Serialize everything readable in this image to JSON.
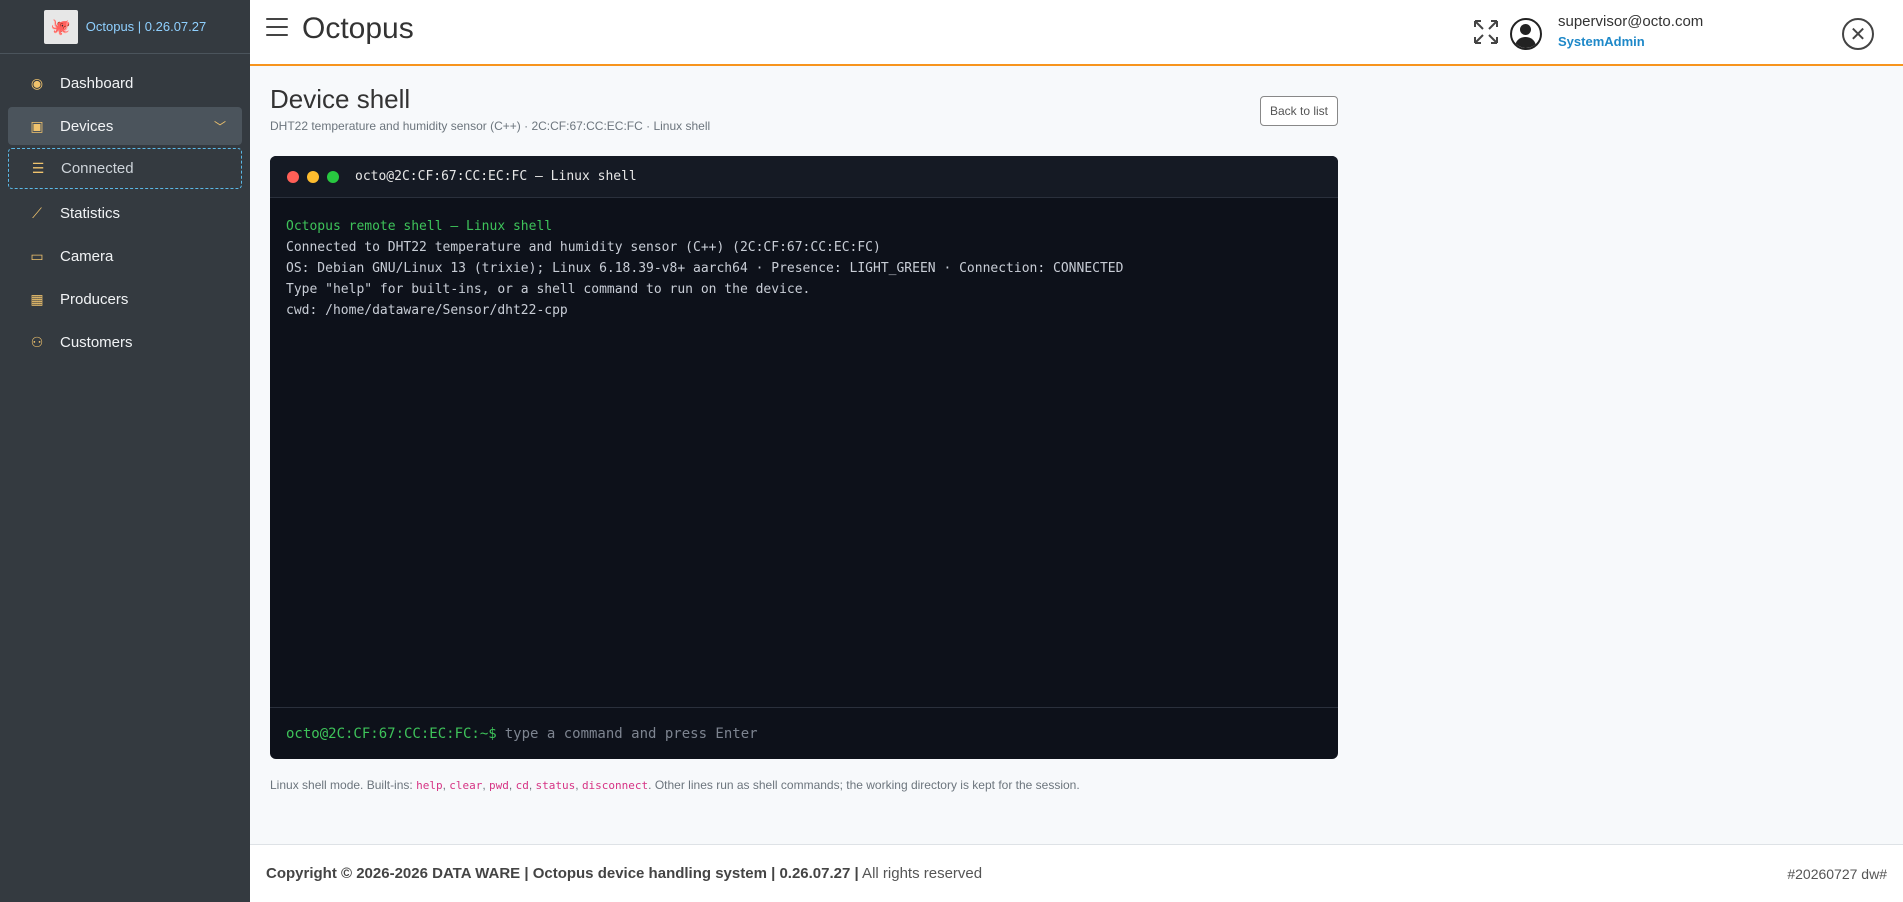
{
  "brand": {
    "name": "Octopus | 0.26.07.27"
  },
  "sidebar": {
    "items": [
      {
        "label": "Dashboard",
        "icon": "palette-icon"
      },
      {
        "label": "Devices",
        "icon": "chip-icon"
      },
      {
        "label": "Connected",
        "icon": "sliders-icon"
      },
      {
        "label": "Statistics",
        "icon": "chart-line-icon"
      },
      {
        "label": "Camera",
        "icon": "video-icon"
      },
      {
        "label": "Producers",
        "icon": "building-icon"
      },
      {
        "label": "Customers",
        "icon": "users-icon"
      }
    ]
  },
  "header": {
    "title": "Octopus",
    "user_email": "supervisor@octo.com",
    "user_role": "SystemAdmin"
  },
  "page": {
    "title": "Device shell",
    "subtitle": "DHT22 temperature and humidity sensor (C++) · 2C:CF:67:CC:EC:FC · Linux shell",
    "back_label": "Back to list"
  },
  "terminal": {
    "title": "octo@2C:CF:67:CC:EC:FC — Linux shell",
    "lines": [
      "Octopus remote shell — Linux shell",
      "Connected to DHT22 temperature and humidity sensor (C++) (2C:CF:67:CC:EC:FC)",
      "OS: Debian GNU/Linux 13 (trixie); Linux 6.18.39-v8+ aarch64 · Presence: LIGHT_GREEN · Connection: CONNECTED",
      "Type \"help\" for built-ins, or a shell command to run on the device.",
      "cwd: /home/dataware/Sensor/dht22-cpp"
    ],
    "prompt": "octo@2C:CF:67:CC:EC:FC:~$",
    "placeholder": "type a command and press Enter"
  },
  "help": {
    "prefix": "Linux shell mode. Built-ins: ",
    "builtins": [
      "help",
      "clear",
      "pwd",
      "cd",
      "status",
      "disconnect"
    ],
    "sep": ", ",
    "suffix": ". Other lines run as shell commands; the working directory is kept for the session."
  },
  "footer": {
    "copyright": "Copyright © 2026-2026 DATA WARE | Octopus device handling system | 0.26.07.27 |",
    "rights": " All rights reserved",
    "build": "#20260727 dw#"
  }
}
